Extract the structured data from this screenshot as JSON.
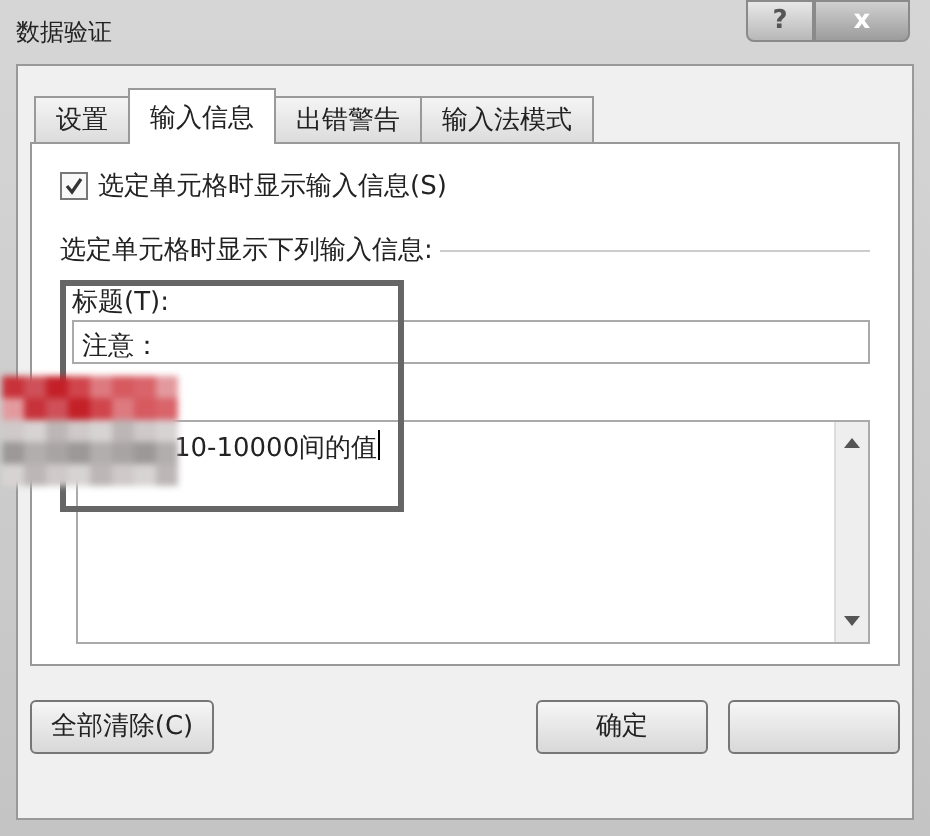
{
  "window": {
    "title": "数据验证",
    "help": "?",
    "close": "x"
  },
  "tabs": [
    {
      "label": "设置",
      "selected": false
    },
    {
      "label": "输入信息",
      "selected": true
    },
    {
      "label": "出错警告",
      "selected": false
    },
    {
      "label": "输入法模式",
      "selected": false
    }
  ],
  "show_message": {
    "label": "选定单元格时显示输入信息(S)",
    "checked": true
  },
  "section_label": "选定单元格时显示下列输入信息:",
  "title_field": {
    "label": "标题(T):",
    "value": "注意："
  },
  "message_field": {
    "value": "10-10000间的值"
  },
  "buttons": [
    {
      "label": "全部清除(C)",
      "kind": "clear"
    },
    {
      "label": "确定",
      "kind": "ok"
    },
    {
      "kind": "cancel"
    }
  ]
}
